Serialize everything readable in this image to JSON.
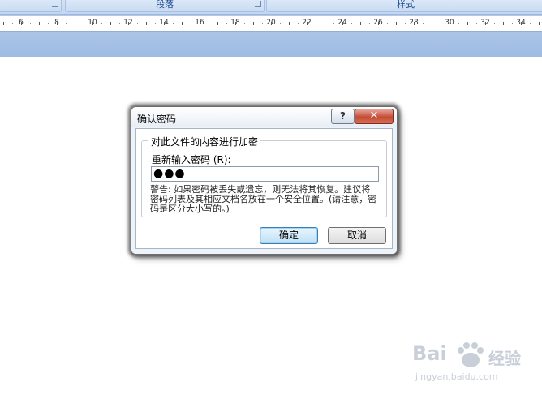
{
  "ribbon": {
    "groups": [
      "",
      "段落",
      "样式"
    ]
  },
  "ruler": {
    "numbers": [
      "6",
      "8",
      "10",
      "12",
      "14",
      "16",
      "18",
      "20",
      "22",
      "24",
      "26",
      "28",
      "30",
      "32",
      "34"
    ]
  },
  "dialog": {
    "title": "确认密码",
    "help_glyph": "?",
    "close_glyph": "✕",
    "group_label": "对此文件的内容进行加密",
    "field_label": "重新输入密码 (R):",
    "password_mask": "●●●",
    "warning": "警告: 如果密码被丢失或遗忘，则无法将其恢复。建议将密码列表及其相应文档名放在一个安全位置。(请注意，密码是区分大小写的。)",
    "ok_label": "确定",
    "cancel_label": "取消"
  },
  "watermark": {
    "logo": "Bai",
    "brand": "经验",
    "url": "jingyan.baidu.com"
  },
  "colors": {
    "ribbon_bg": "#c2d6f0",
    "ruler_band": "#9ebbe2",
    "close_red": "#c44c36",
    "ok_blue": "#bfe0f6"
  }
}
